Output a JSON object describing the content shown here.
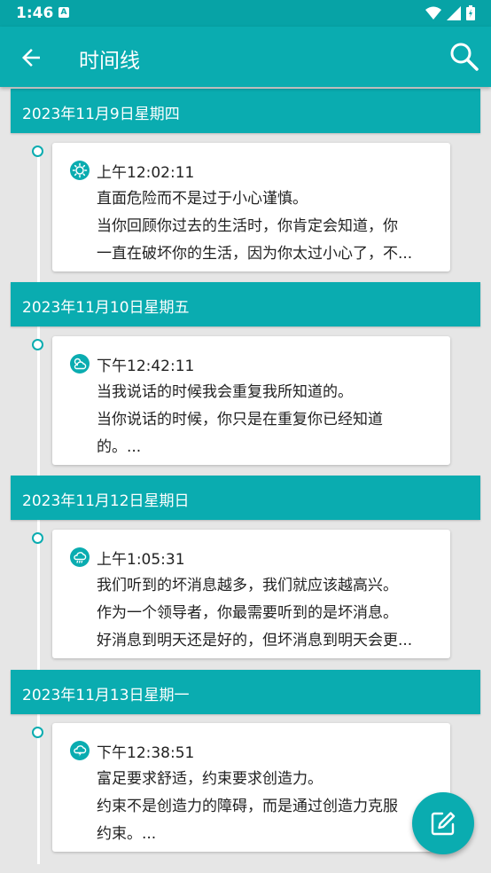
{
  "status_bar": {
    "time": "1:46",
    "notif_icon": "A"
  },
  "app_bar": {
    "title": "时间线"
  },
  "entries": [
    {
      "date": "2023年11月9日星期四",
      "time": "上午12:02:11",
      "icon": "sun-icon",
      "lines": [
        "直面危险而不是过于小心谨慎。",
        "当你回顾你过去的生活时，你肯定会知道，你",
        "一直在破坏你的生活，因为你太过小心了，不..."
      ]
    },
    {
      "date": "2023年11月10日星期五",
      "time": "下午12:42:11",
      "icon": "partly-cloudy-icon",
      "lines": [
        "当我说话的时候我会重复我所知道的。",
        "当你说话的时候，你只是在重复你已经知道",
        "的。..."
      ]
    },
    {
      "date": "2023年11月12日星期日",
      "time": "上午1:05:31",
      "icon": "rain-icon",
      "lines": [
        "我们听到的坏消息越多，我们就应该越高兴。",
        "作为一个领导者，你最需要听到的是坏消息。",
        "好消息到明天还是好的，但坏消息到明天会更..."
      ]
    },
    {
      "date": "2023年11月13日星期一",
      "time": "下午12:38:51",
      "icon": "thunderstorm-icon",
      "lines": [
        "富足要求舒适，约束要求创造力。",
        "约束不是创造力的障碍，而是通过创造力克服",
        "约束。..."
      ]
    }
  ],
  "colors": {
    "primary": "#0aacb0",
    "status_bar": "#07a3a6",
    "background": "#e6e6e6"
  }
}
